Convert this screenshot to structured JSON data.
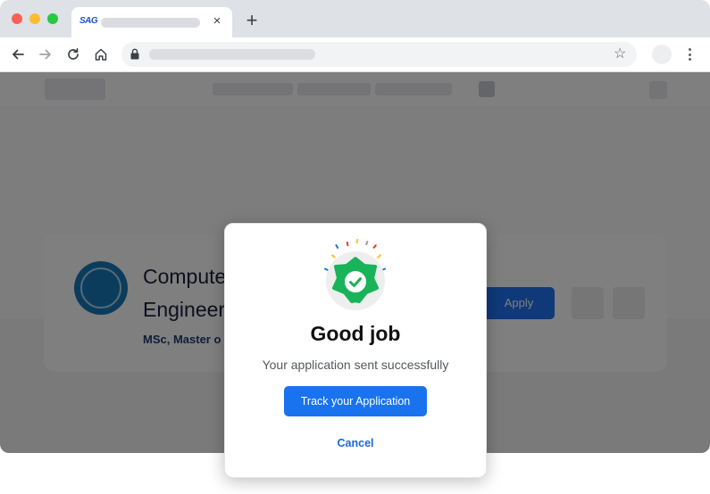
{
  "browser": {
    "tab": {
      "favicon_text": "SAG",
      "close_glyph": "×"
    },
    "new_tab_glyph": "+",
    "toolbar": {
      "icons": [
        "back-arrow-icon",
        "forward-arrow-icon",
        "reload-icon",
        "home-icon",
        "lock-icon",
        "star-icon",
        "profile-avatar",
        "more-menu-icon"
      ]
    }
  },
  "page": {
    "card": {
      "title": "Compute\nEngineer",
      "degree": "MSc, Master o",
      "apply_label": "Apply"
    }
  },
  "modal": {
    "icon": "success-badge-check-icon",
    "title": "Good job",
    "message": "Your application sent successfully",
    "primary_button": "Track your Application",
    "secondary_link": "Cancel"
  },
  "colors": {
    "accent": "#1973ef",
    "badge_green": "#19b35a",
    "overlay": "rgba(0,0,0,0.5)"
  }
}
